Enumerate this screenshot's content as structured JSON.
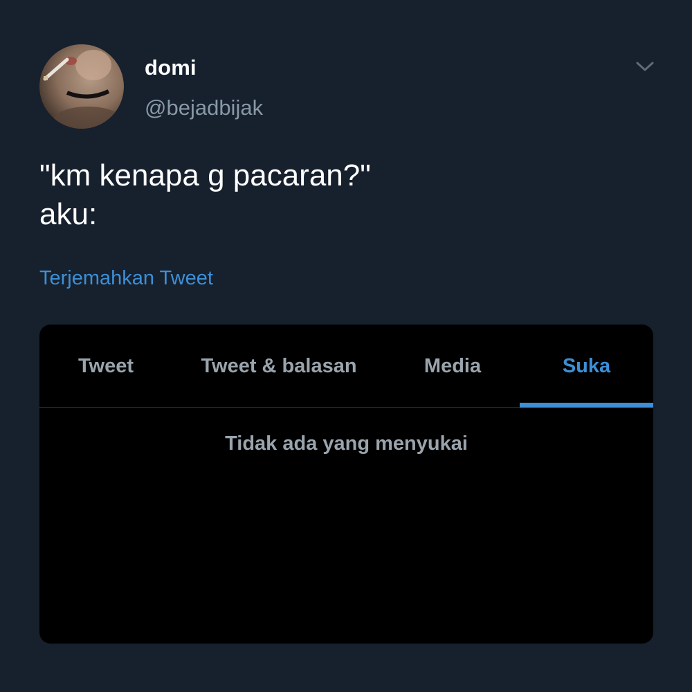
{
  "tweet": {
    "display_name": "domi",
    "handle": "@bejadbijak",
    "text": "\"km kenapa g pacaran?\"\naku:",
    "translate_label": "Terjemahkan Tweet",
    "menu_icon": "chevron-down-icon"
  },
  "embedded_card": {
    "tabs": [
      {
        "label": "Tweet",
        "selected": false
      },
      {
        "label": "Tweet & balasan",
        "selected": false
      },
      {
        "label": "Media",
        "selected": false
      },
      {
        "label": "Suka",
        "selected": true
      }
    ],
    "empty_message": "Tidak ada yang menyukai"
  },
  "colors": {
    "background": "#17202d",
    "accent": "#3d8fd6",
    "muted_text": "#8899a6",
    "card_background": "#000000"
  }
}
